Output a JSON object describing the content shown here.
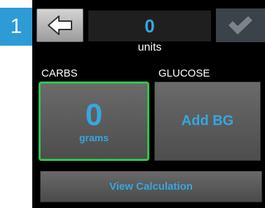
{
  "step": "1",
  "header": {
    "back_icon": "arrow-left-icon",
    "units_value": "0",
    "units_label": "units",
    "confirm_icon": "checkmark-icon"
  },
  "carbs": {
    "label": "CARBS",
    "value": "0",
    "unit": "grams"
  },
  "glucose": {
    "label": "GLUCOSE",
    "button_label": "Add BG"
  },
  "footer": {
    "view_calculation_label": "View Calculation"
  },
  "colors": {
    "accent_blue": "#35a7e0",
    "selected_border": "#32c34f",
    "step_badge": "#2d9bd6"
  }
}
